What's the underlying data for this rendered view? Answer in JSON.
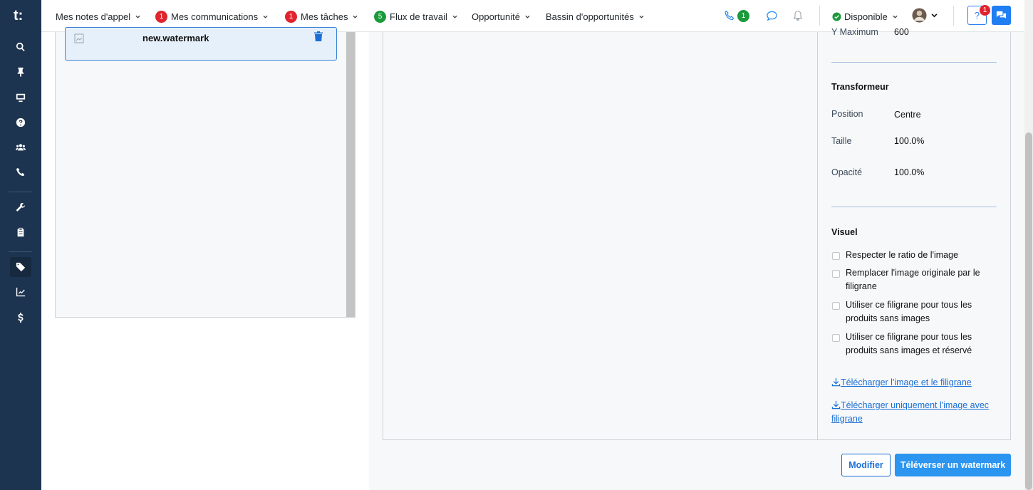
{
  "nav": {
    "items": [
      {
        "label": "Mes notes d'appel",
        "badge": ""
      },
      {
        "label": "Mes communications",
        "badge": "1"
      },
      {
        "label": "Mes tâches",
        "badge": "1"
      },
      {
        "label": "Flux de travail",
        "badge": "5"
      },
      {
        "label": "Opportunité",
        "badge": ""
      },
      {
        "label": "Bassin d'opportunités",
        "badge": ""
      }
    ],
    "phone_badge": "1",
    "status_label": "Disponible",
    "help_label": "?",
    "help_badge": "1"
  },
  "sidebar": {
    "logo": "t:",
    "icons": [
      "search-icon",
      "pin-icon",
      "monitor-icon",
      "help-circle-icon",
      "users-icon",
      "phone-icon",
      "wrench-icon",
      "clipboard-icon",
      "tag-icon",
      "chart-line-icon",
      "dollar-icon"
    ]
  },
  "watermarks": {
    "items": [
      {
        "name": "new.watermark"
      }
    ]
  },
  "props": {
    "y_max_label": "Y Maximum",
    "y_max_value": "600",
    "transformer_title": "Transformeur",
    "position_label": "Position",
    "position_value": "Centre",
    "size_label": "Taille",
    "size_value": "100.0%",
    "opacity_label": "Opacité",
    "opacity_value": "100.0%",
    "visual_title": "Visuel",
    "checkboxes": [
      "Respecter le ratio de l'image",
      "Remplacer l'image originale par le filigrane",
      "Utiliser ce filigrane pour tous les produits sans images",
      "Utiliser ce filigrane pour tous les produits sans images et réservé"
    ],
    "download_both": "Télécharger l'image et le filigrane",
    "download_only": "Télécharger uniquement l'image avec filigrane"
  },
  "actions": {
    "modify": "Modifier",
    "upload": "Téléverser un watermark"
  },
  "colors": {
    "sidebar": "#1c3450",
    "accent": "#1a6fd6",
    "badge_red": "#e0242f",
    "badge_green": "#1b9a3c"
  }
}
